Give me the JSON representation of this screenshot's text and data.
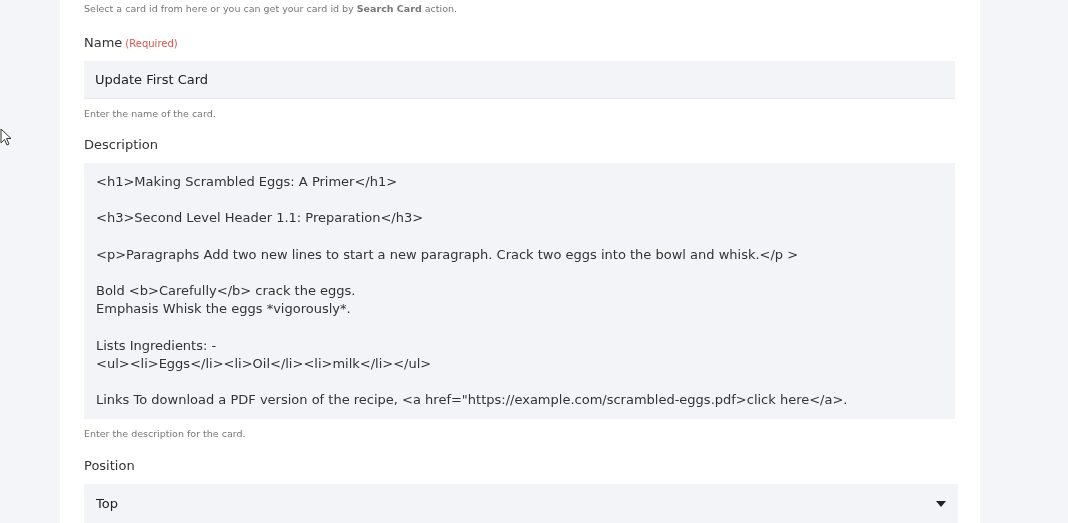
{
  "intro_hint": "Select a card id from here or you can get your card id by **Search Card** action.",
  "fields": [
    {
      "kind": "input",
      "label": "Name",
      "required_text": "(Required)",
      "value": "Update First Card",
      "hint": "Enter the name of the card."
    },
    {
      "kind": "textarea",
      "label": "Description",
      "value": "<h1>Making Scrambled Eggs: A Primer</h1>\n\n<h3>Second Level Header 1.1: Preparation</h3>\n\n<p>Paragraphs Add two new lines to start a new paragraph. Crack two eggs into the bowl and whisk.</p >\n\nBold <b>Carefully</b> crack the eggs.\nEmphasis Whisk the eggs *vigorously*.\n\nLists Ingredients: -\n<ul><li>Eggs</li><li>Oil</li><li>milk</li></ul>\n\nLinks To download a PDF version of the recipe, <a href=\"https://example.com/scrambled-eggs.pdf>click here</a>.",
      "hint": "Enter the description for the card."
    },
    {
      "kind": "select",
      "label": "Position",
      "value": "Top"
    }
  ]
}
